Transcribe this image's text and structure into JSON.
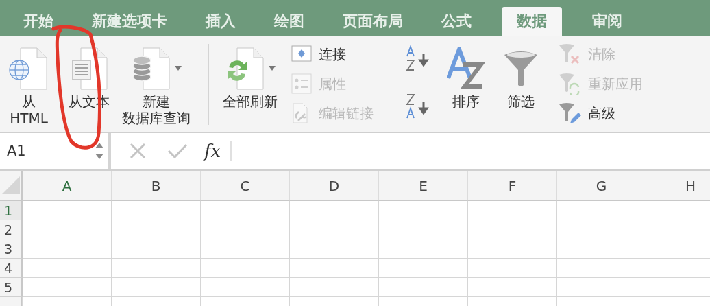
{
  "tabs": [
    {
      "label": "开始",
      "selected": false
    },
    {
      "label": "新建选项卡",
      "selected": false
    },
    {
      "label": "插入",
      "selected": false
    },
    {
      "label": "绘图",
      "selected": false
    },
    {
      "label": "页面布局",
      "selected": false
    },
    {
      "label": "公式",
      "selected": false
    },
    {
      "label": "数据",
      "selected": true
    },
    {
      "label": "审阅",
      "selected": false
    }
  ],
  "ribbon": {
    "get_external": [
      {
        "kind": "html",
        "lines": [
          "从",
          "HTML"
        ],
        "has_menu": false
      },
      {
        "kind": "text",
        "lines": [
          "从文本"
        ],
        "has_menu": false
      },
      {
        "kind": "query",
        "lines": [
          "新建",
          "数据库查询"
        ],
        "has_menu": true
      }
    ],
    "refresh": {
      "label": "全部刷新",
      "has_menu": true
    },
    "connections": [
      {
        "kind": "connection",
        "label": "连接",
        "disabled": false
      },
      {
        "kind": "properties",
        "label": "属性",
        "disabled": true
      },
      {
        "kind": "link",
        "label": "编辑链接",
        "disabled": true
      }
    ],
    "sort": {
      "label": "排序"
    },
    "filter": {
      "label": "筛选"
    },
    "filter_options": [
      {
        "kind": "clear",
        "label": "清除",
        "disabled": true
      },
      {
        "kind": "reapply",
        "label": "重新应用",
        "disabled": true
      },
      {
        "kind": "advanced",
        "label": "高级",
        "disabled": false
      }
    ]
  },
  "formula_bar": {
    "name_box": "A1",
    "fx": "fx"
  },
  "sheet": {
    "columns": [
      {
        "label": "A",
        "selected": true
      },
      {
        "label": "B",
        "selected": false
      },
      {
        "label": "C",
        "selected": false
      },
      {
        "label": "D",
        "selected": false
      },
      {
        "label": "E",
        "selected": false
      },
      {
        "label": "F",
        "selected": false
      },
      {
        "label": "G",
        "selected": false
      },
      {
        "label": "H",
        "selected": false
      }
    ],
    "rows": [
      {
        "label": "1",
        "selected": true
      },
      {
        "label": "2",
        "selected": false
      },
      {
        "label": "3",
        "selected": false
      },
      {
        "label": "4",
        "selected": false
      },
      {
        "label": "5",
        "selected": false
      }
    ]
  }
}
